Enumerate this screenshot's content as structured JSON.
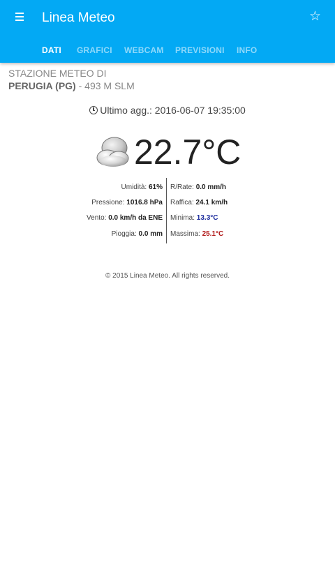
{
  "app": {
    "title": "Linea Meteo",
    "primary_color": "#03a9f4"
  },
  "icons": {
    "menu": "menu-icon",
    "star": "star-outline-icon",
    "clock": "clock-icon",
    "weather": "partly-cloudy-icon"
  },
  "tabs": [
    {
      "label": "DATI",
      "active": true
    },
    {
      "label": "GRAFICI",
      "active": false
    },
    {
      "label": "WEBCAM",
      "active": false
    },
    {
      "label": "PREVISIONI",
      "active": false
    },
    {
      "label": "INFO",
      "active": false
    }
  ],
  "station": {
    "line1": "STAZIONE METEO DI",
    "city": "PERUGIA (PG)",
    "altitude": " - 493 M SLM"
  },
  "update": {
    "label": "Ultimo agg.: ",
    "timestamp": "2016-06-07 19:35:00"
  },
  "current": {
    "temperature": "22.7°C"
  },
  "stats": {
    "left": [
      {
        "label": "Umidità: ",
        "value": "61%"
      },
      {
        "label": "Pressione: ",
        "value": "1016.8 hPa"
      },
      {
        "label": "Vento: ",
        "value": "0.0 km/h da ENE"
      },
      {
        "label": "Pioggia: ",
        "value": "0.0 mm"
      }
    ],
    "right": [
      {
        "label": "R/Rate: ",
        "value": "0.0 mm/h"
      },
      {
        "label": "Raffica: ",
        "value": "24.1 km/h"
      },
      {
        "label": "Minima: ",
        "value": "13.3°C",
        "color": "#1a2a9c"
      },
      {
        "label": "Massima: ",
        "value": "25.1°C",
        "color": "#b01818"
      }
    ]
  },
  "footer": {
    "text": "© 2015 Linea Meteo. All rights reserved."
  }
}
